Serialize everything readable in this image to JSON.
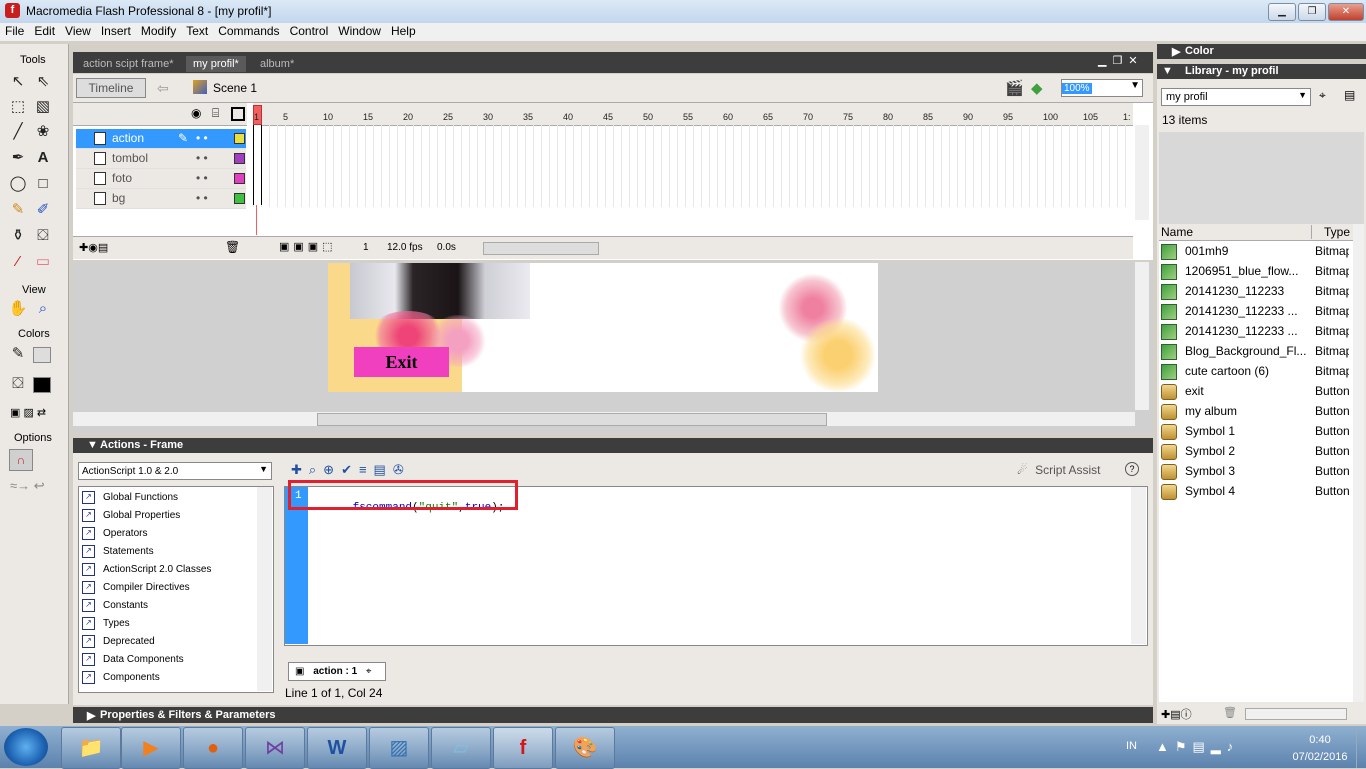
{
  "window": {
    "title": "Macromedia Flash Professional 8 - [my profil*]"
  },
  "menu": [
    "File",
    "Edit",
    "View",
    "Insert",
    "Modify",
    "Text",
    "Commands",
    "Control",
    "Window",
    "Help"
  ],
  "tools": {
    "header": "Tools",
    "view_header": "View",
    "colors_header": "Colors",
    "options_header": "Options"
  },
  "doc_tabs": [
    "action scipt frame*",
    "my profil*",
    "album*"
  ],
  "timeline": {
    "toggle_label": "Timeline",
    "scene_label": "Scene 1",
    "zoom": "100%",
    "layers": [
      {
        "name": "action",
        "color": "#e8e040"
      },
      {
        "name": "tombol",
        "color": "#a040c0"
      },
      {
        "name": "foto",
        "color": "#e040c0"
      },
      {
        "name": "bg",
        "color": "#40c040"
      }
    ],
    "ruler": [
      "1",
      "5",
      "10",
      "15",
      "20",
      "25",
      "30",
      "35",
      "40",
      "45",
      "50",
      "55",
      "60",
      "65",
      "70",
      "75",
      "80",
      "85",
      "90",
      "95",
      "100",
      "105",
      "1:"
    ],
    "current_frame": "1",
    "fps": "12.0 fps",
    "time": "0.0s"
  },
  "stage": {
    "exit_button_label": "Exit"
  },
  "actions": {
    "header": "Actions - Frame",
    "version_select": "ActionScript 1.0 & 2.0",
    "tree": [
      "Global Functions",
      "Global Properties",
      "Operators",
      "Statements",
      "ActionScript 2.0 Classes",
      "Compiler Directives",
      "Constants",
      "Types",
      "Deprecated",
      "Data Components",
      "Components"
    ],
    "script_assist": "Script Assist",
    "code_line_number": "1",
    "code_parts": {
      "fn": "fscommand",
      "open": "(",
      "str": "\"quit\"",
      "comma": ",",
      "bool": "true",
      "close": ");"
    },
    "frame_tab": "action : 1",
    "status": "Line 1 of 1, Col 24"
  },
  "properties": {
    "header": "Properties & Filters & Parameters"
  },
  "right_panel": {
    "color_header": "Color",
    "library_header": "Library - my profil",
    "library_select": "my profil",
    "item_count": "13 items",
    "col_name": "Name",
    "col_type": "Type",
    "items": [
      {
        "name": "001mh9",
        "type": "Bitmap",
        "kind": "bitmap"
      },
      {
        "name": "1206951_blue_flow...",
        "type": "Bitmap",
        "kind": "bitmap"
      },
      {
        "name": "20141230_112233",
        "type": "Bitmap",
        "kind": "bitmap"
      },
      {
        "name": "20141230_112233 ...",
        "type": "Bitmap",
        "kind": "bitmap"
      },
      {
        "name": "20141230_112233 ...",
        "type": "Bitmap",
        "kind": "bitmap"
      },
      {
        "name": "Blog_Background_Fl...",
        "type": "Bitmap",
        "kind": "bitmap"
      },
      {
        "name": "cute cartoon (6)",
        "type": "Bitmap",
        "kind": "bitmap"
      },
      {
        "name": "exit",
        "type": "Button",
        "kind": "button"
      },
      {
        "name": "my album",
        "type": "Button",
        "kind": "button"
      },
      {
        "name": "Symbol 1",
        "type": "Button",
        "kind": "button"
      },
      {
        "name": "Symbol 2",
        "type": "Button",
        "kind": "button"
      },
      {
        "name": "Symbol 3",
        "type": "Button",
        "kind": "button"
      },
      {
        "name": "Symbol 4",
        "type": "Button",
        "kind": "button"
      }
    ]
  },
  "taskbar": {
    "lang": "IN",
    "time": "0:40",
    "date": "07/02/2016"
  },
  "colors": {
    "highlight_box": "#e0202e",
    "accent_blue": "#3399ff",
    "panel_dark": "#3d3d3d",
    "exit_button": "#f040c0"
  }
}
